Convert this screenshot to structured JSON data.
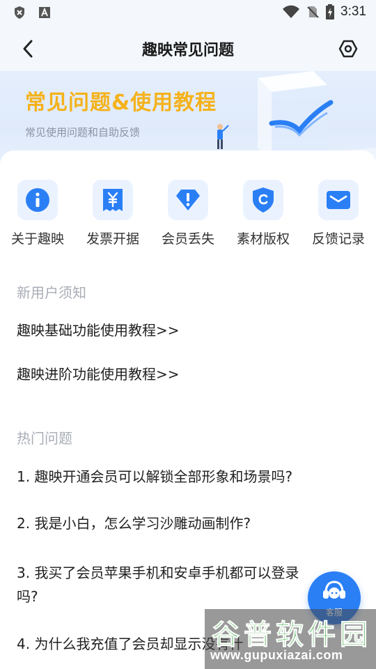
{
  "status_bar": {
    "time": "3:31",
    "icons": [
      "shield-x-icon",
      "font-a-icon",
      "wifi-icon",
      "no-sim-icon",
      "battery-charging-icon"
    ]
  },
  "header": {
    "title": "趣映常见问题",
    "back_icon": "chevron-left-icon",
    "settings_icon": "hexagon-settings-icon"
  },
  "banner": {
    "title": "常见问题&使用教程",
    "subtitle": "常见使用问题和自助反馈"
  },
  "shortcuts": [
    {
      "label": "关于趣映",
      "icon": "info-icon",
      "color": "#2a7ff5"
    },
    {
      "label": "发票开据",
      "icon": "receipt-yen-icon",
      "color": "#2a7ff5"
    },
    {
      "label": "会员丢失",
      "icon": "diamond-alert-icon",
      "color": "#2a7ff5"
    },
    {
      "label": "素材版权",
      "icon": "shield-copyright-icon",
      "color": "#2a7ff5"
    },
    {
      "label": "反馈记录",
      "icon": "mail-icon",
      "color": "#2a7ff5"
    }
  ],
  "sections": {
    "new_user": {
      "heading": "新用户须知",
      "items": [
        "趣映基础功能使用教程>>",
        "趣映进阶功能使用教程>>"
      ]
    },
    "hot": {
      "heading": "热门问题",
      "items": [
        "1. 趣映开通会员可以解锁全部形象和场景吗?",
        "2. 我是小白，怎么学习沙雕动画制作?",
        "3. 我买了会员苹果手机和安卓手机都可以登录",
        "吗?",
        "4. 为什么我充值了会员却显示没有什"
      ]
    }
  },
  "service": {
    "label": "客服",
    "icon": "headset-icon"
  },
  "watermark": {
    "line1": "谷普软件园",
    "line2": "www.gupuxiazai.com"
  },
  "colors": {
    "accent": "#2a7ff5",
    "banner_title": "#f5b21b",
    "section_head": "#a8adb5"
  }
}
